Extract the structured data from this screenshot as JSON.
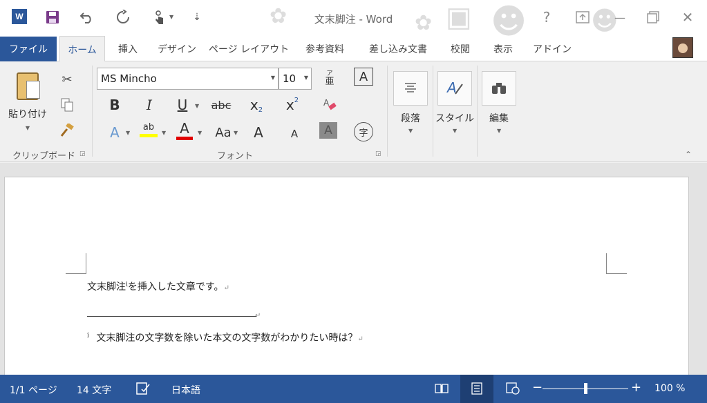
{
  "app": {
    "window_title": "文末脚注 - Word",
    "word_logo": "W"
  },
  "titlebar": {
    "icons": [
      "word-icon",
      "save-icon",
      "undo-icon",
      "redo-icon",
      "touch-mode-icon",
      "customize-qat-icon"
    ],
    "help": "?",
    "minimize": "—",
    "close": "✕"
  },
  "tabs": {
    "file": "ファイル",
    "items": [
      {
        "label": "ホーム",
        "active": true
      },
      {
        "label": "挿入"
      },
      {
        "label": "デザイン"
      },
      {
        "label": "ページ レイアウト"
      },
      {
        "label": "参考資料"
      },
      {
        "label": "差し込み文書"
      },
      {
        "label": "校閲"
      },
      {
        "label": "表示"
      },
      {
        "label": "アドイン"
      }
    ]
  },
  "ribbon": {
    "clipboard": {
      "paste_label": "貼り付け",
      "group_label": "クリップボード"
    },
    "font": {
      "font_name": "MS Mincho",
      "font_size": "10",
      "bold": "B",
      "italic": "I",
      "underline": "U",
      "strike": "abc",
      "subscript": "x",
      "subscript_mark": "2",
      "superscript": "x",
      "superscript_mark": "2",
      "highlight": "ab",
      "font_color": "A",
      "change_case": "Aa",
      "grow": "A",
      "shrink": "A",
      "shading": "A",
      "enclose": "字",
      "text_effect": "A",
      "border_char": "A",
      "group_label": "フォント"
    },
    "paragraph": {
      "label": "段落"
    },
    "styles": {
      "label": "スタイル"
    },
    "editing": {
      "label": "編集"
    }
  },
  "document": {
    "body_text": "文末脚注",
    "body_ref": "i",
    "body_rest": "を挿入した文章です。",
    "footnote_ref": "i",
    "footnote_text": "文末脚注の文字数を除いた本文の文字数がわかりたい時は？",
    "para_mark": "↵"
  },
  "statusbar": {
    "page": "1/1 ページ",
    "words": "14 文字",
    "language": "日本語",
    "zoom_minus": "−",
    "zoom_plus": "+",
    "zoom": "100 %"
  },
  "colors": {
    "accent": "#2b579a",
    "status_bg": "#2b579a"
  }
}
